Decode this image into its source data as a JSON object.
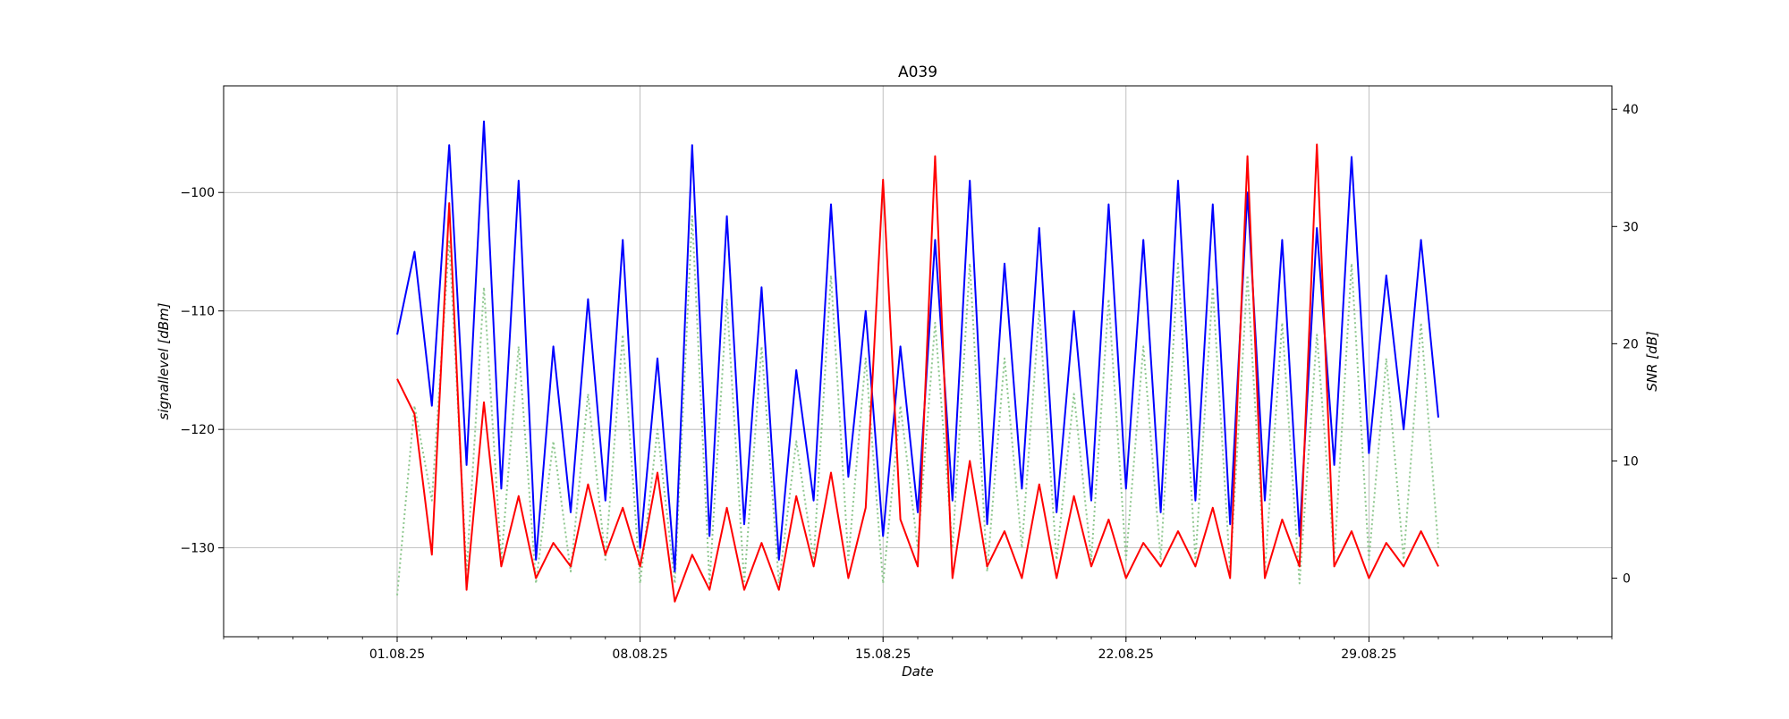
{
  "chart_data": {
    "type": "line",
    "title": "A039",
    "xlabel": "Date",
    "ylabel_left": "signallevel [dBm]",
    "ylabel_right": "SNR [dB]",
    "grid": true,
    "x_range": [
      "2025-07-27",
      "2025-09-05"
    ],
    "ylim_left": [
      -137.5,
      -91
    ],
    "ylim_right": [
      -5,
      42
    ],
    "x_ticks": [
      "01.08.25",
      "08.08.25",
      "15.08.25",
      "22.08.25",
      "29.08.25"
    ],
    "y_ticks_left": [
      -100,
      -110,
      -120,
      -130
    ],
    "y_ticks_right": [
      40,
      30,
      20,
      10,
      0
    ],
    "colors": {
      "signal_max": "#0000ff",
      "signal_dotted": "#90c890",
      "snr": "#ff0000"
    },
    "series": [
      {
        "axis": "left",
        "style": "solid",
        "color": "#0000ff",
        "x": [
          "2025-08-01",
          "2025-08-01T12:00",
          "2025-08-02",
          "2025-08-02T12:00",
          "2025-08-03",
          "2025-08-03T12:00",
          "2025-08-04",
          "2025-08-04T12:00",
          "2025-08-05",
          "2025-08-05T12:00",
          "2025-08-06",
          "2025-08-06T12:00",
          "2025-08-07",
          "2025-08-07T12:00",
          "2025-08-08",
          "2025-08-08T12:00",
          "2025-08-09",
          "2025-08-09T12:00",
          "2025-08-10",
          "2025-08-10T12:00",
          "2025-08-11",
          "2025-08-11T12:00",
          "2025-08-12",
          "2025-08-12T12:00",
          "2025-08-13",
          "2025-08-13T12:00",
          "2025-08-14",
          "2025-08-14T12:00",
          "2025-08-15",
          "2025-08-15T12:00",
          "2025-08-16",
          "2025-08-16T12:00",
          "2025-08-17",
          "2025-08-17T12:00",
          "2025-08-18",
          "2025-08-18T12:00",
          "2025-08-19",
          "2025-08-19T12:00",
          "2025-08-20",
          "2025-08-20T12:00",
          "2025-08-21",
          "2025-08-21T12:00",
          "2025-08-22",
          "2025-08-22T12:00",
          "2025-08-23",
          "2025-08-23T12:00",
          "2025-08-24",
          "2025-08-24T12:00",
          "2025-08-25",
          "2025-08-25T12:00",
          "2025-08-26",
          "2025-08-26T12:00",
          "2025-08-27",
          "2025-08-27T12:00",
          "2025-08-28",
          "2025-08-28T12:00",
          "2025-08-29",
          "2025-08-29T12:00",
          "2025-08-30",
          "2025-08-30T12:00",
          "2025-08-31"
        ],
        "y": [
          -112,
          -105,
          -118,
          -96,
          -123,
          -94,
          -125,
          -99,
          -131,
          -113,
          -127,
          -109,
          -126,
          -104,
          -130,
          -114,
          -132,
          -96,
          -129,
          -102,
          -128,
          -108,
          -131,
          -115,
          -126,
          -101,
          -124,
          -110,
          -129,
          -113,
          -127,
          -104,
          -126,
          -99,
          -128,
          -106,
          -125,
          -103,
          -127,
          -110,
          -126,
          -101,
          -125,
          -104,
          -127,
          -99,
          -126,
          -101,
          -128,
          -100,
          -126,
          -104,
          -129,
          -103,
          -123,
          -97,
          -122,
          -107,
          -120,
          -104,
          -119
        ]
      },
      {
        "axis": "left",
        "style": "dotted",
        "color": "#90c890",
        "x": [
          "2025-08-01",
          "2025-08-01T12:00",
          "2025-08-02",
          "2025-08-02T12:00",
          "2025-08-03",
          "2025-08-03T12:00",
          "2025-08-04",
          "2025-08-04T12:00",
          "2025-08-05",
          "2025-08-05T12:00",
          "2025-08-06",
          "2025-08-06T12:00",
          "2025-08-07",
          "2025-08-07T12:00",
          "2025-08-08",
          "2025-08-08T12:00",
          "2025-08-09",
          "2025-08-09T12:00",
          "2025-08-10",
          "2025-08-10T12:00",
          "2025-08-11",
          "2025-08-11T12:00",
          "2025-08-12",
          "2025-08-12T12:00",
          "2025-08-13",
          "2025-08-13T12:00",
          "2025-08-14",
          "2025-08-14T12:00",
          "2025-08-15",
          "2025-08-15T12:00",
          "2025-08-16",
          "2025-08-16T12:00",
          "2025-08-17",
          "2025-08-17T12:00",
          "2025-08-18",
          "2025-08-18T12:00",
          "2025-08-19",
          "2025-08-19T12:00",
          "2025-08-20",
          "2025-08-20T12:00",
          "2025-08-21",
          "2025-08-21T12:00",
          "2025-08-22",
          "2025-08-22T12:00",
          "2025-08-23",
          "2025-08-23T12:00",
          "2025-08-24",
          "2025-08-24T12:00",
          "2025-08-25",
          "2025-08-25T12:00",
          "2025-08-26",
          "2025-08-26T12:00",
          "2025-08-27",
          "2025-08-27T12:00",
          "2025-08-28",
          "2025-08-28T12:00",
          "2025-08-29",
          "2025-08-29T12:00",
          "2025-08-30",
          "2025-08-30T12:00",
          "2025-08-31"
        ],
        "y": [
          -134,
          -118,
          -126,
          -104,
          -132,
          -108,
          -131,
          -113,
          -133,
          -121,
          -132,
          -117,
          -131,
          -112,
          -133,
          -120,
          -133,
          -102,
          -133,
          -109,
          -133,
          -113,
          -133,
          -121,
          -131,
          -107,
          -131,
          -114,
          -133,
          -118,
          -130,
          -111,
          -130,
          -106,
          -132,
          -114,
          -130,
          -110,
          -131,
          -117,
          -131,
          -109,
          -131,
          -113,
          -131,
          -106,
          -131,
          -108,
          -132,
          -107,
          -132,
          -111,
          -133,
          -112,
          -131,
          -106,
          -131,
          -114,
          -131,
          -111,
          -130
        ]
      },
      {
        "axis": "right",
        "style": "solid",
        "color": "#ff0000",
        "x": [
          "2025-08-01",
          "2025-08-01T12:00",
          "2025-08-02",
          "2025-08-02T12:00",
          "2025-08-03",
          "2025-08-03T12:00",
          "2025-08-04",
          "2025-08-04T12:00",
          "2025-08-05",
          "2025-08-05T12:00",
          "2025-08-06",
          "2025-08-06T12:00",
          "2025-08-07",
          "2025-08-07T12:00",
          "2025-08-08",
          "2025-08-08T12:00",
          "2025-08-09",
          "2025-08-09T12:00",
          "2025-08-10",
          "2025-08-10T12:00",
          "2025-08-11",
          "2025-08-11T12:00",
          "2025-08-12",
          "2025-08-12T12:00",
          "2025-08-13",
          "2025-08-13T12:00",
          "2025-08-14",
          "2025-08-14T12:00",
          "2025-08-15",
          "2025-08-15T12:00",
          "2025-08-16",
          "2025-08-16T12:00",
          "2025-08-17",
          "2025-08-17T12:00",
          "2025-08-18",
          "2025-08-18T12:00",
          "2025-08-19",
          "2025-08-19T12:00",
          "2025-08-20",
          "2025-08-20T12:00",
          "2025-08-21",
          "2025-08-21T12:00",
          "2025-08-22",
          "2025-08-22T12:00",
          "2025-08-23",
          "2025-08-23T12:00",
          "2025-08-24",
          "2025-08-24T12:00",
          "2025-08-25",
          "2025-08-25T12:00",
          "2025-08-26",
          "2025-08-26T12:00",
          "2025-08-27",
          "2025-08-27T12:00",
          "2025-08-28",
          "2025-08-28T12:00",
          "2025-08-29",
          "2025-08-29T12:00",
          "2025-08-30",
          "2025-08-30T12:00",
          "2025-08-31"
        ],
        "y": [
          17,
          14,
          2,
          32,
          -1,
          15,
          1,
          7,
          0,
          3,
          1,
          8,
          2,
          6,
          1,
          9,
          -2,
          2,
          -1,
          6,
          -1,
          3,
          -1,
          7,
          1,
          9,
          0,
          6,
          34,
          5,
          1,
          36,
          0,
          10,
          1,
          4,
          0,
          8,
          0,
          7,
          1,
          5,
          0,
          3,
          1,
          4,
          1,
          6,
          0,
          36,
          0,
          5,
          1,
          37,
          1,
          4,
          0,
          3,
          1,
          4,
          1
        ]
      }
    ]
  }
}
